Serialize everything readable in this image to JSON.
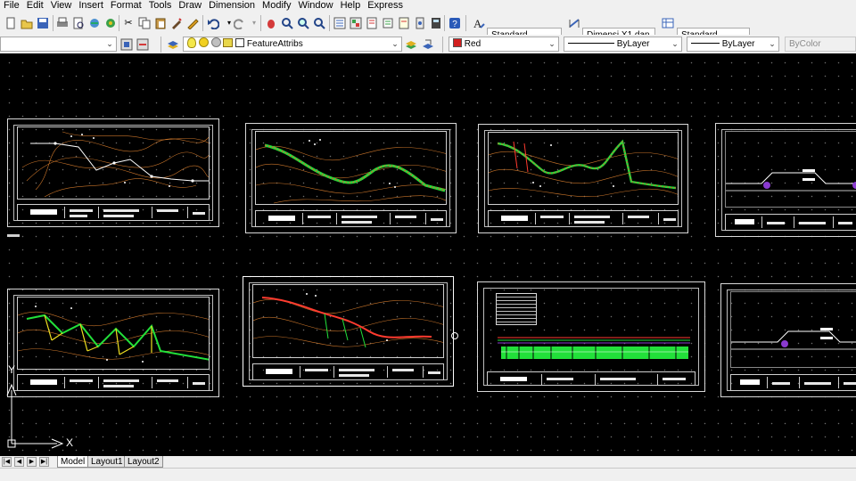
{
  "menu": [
    "File",
    "Edit",
    "View",
    "Insert",
    "Format",
    "Tools",
    "Draw",
    "Dimension",
    "Modify",
    "Window",
    "Help",
    "Express"
  ],
  "toolbar_top": {
    "text_style": "Standard",
    "dim_style": "Dimensi X1 dan",
    "table_style": "Standard"
  },
  "toolbar_props": {
    "layer": "FeatureAttribs",
    "color": "Red",
    "linetype": "ByLayer",
    "lineweight": "ByLayer",
    "plotstyle": "ByColor"
  },
  "canvas": {
    "ucs_x": "X",
    "ucs_y": "Y"
  },
  "tabs": [
    "Model",
    "Layout1",
    "Layout2"
  ],
  "colors": {
    "canvas": "#000000",
    "contour": "#c8742a",
    "profile_green": "#22e03a",
    "route_red": "#ff3b2f",
    "accent_yellow": "#f0e020",
    "color_swatch": "#d21f1f"
  }
}
